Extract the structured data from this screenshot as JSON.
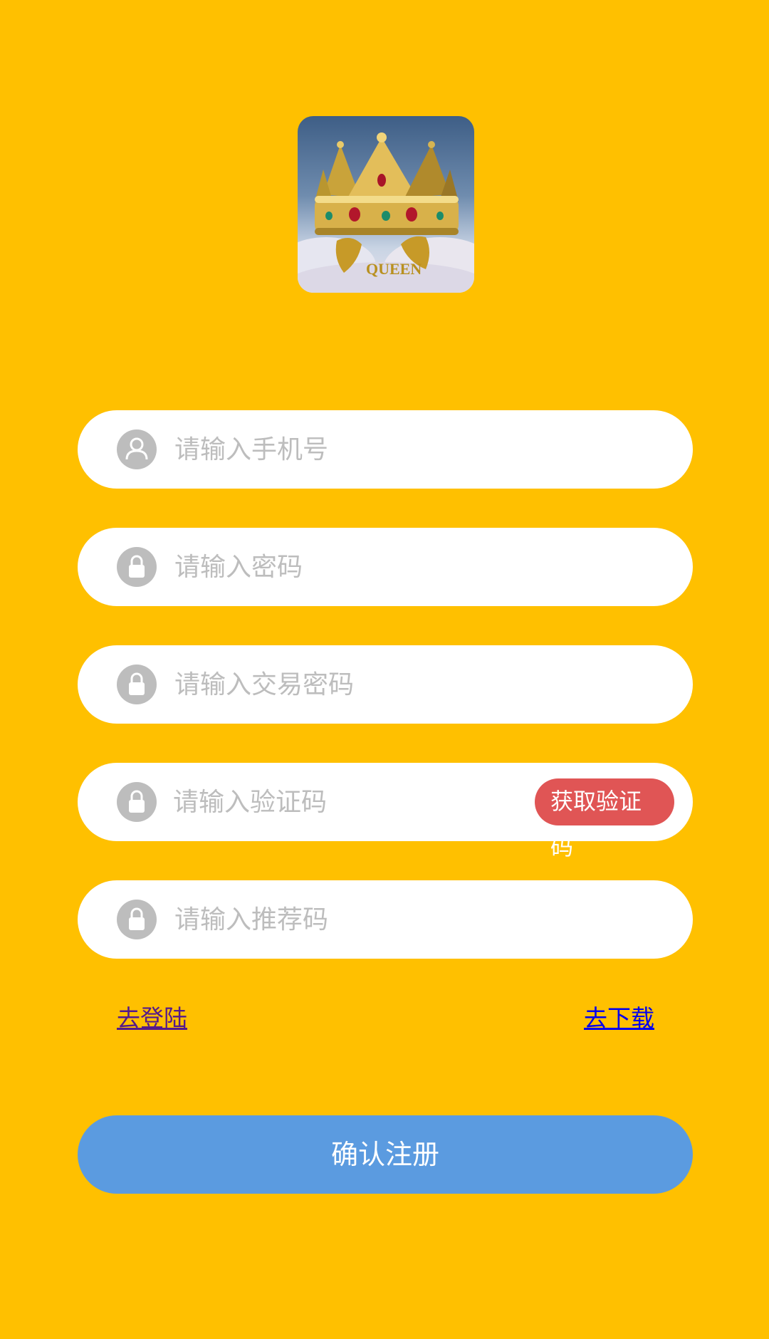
{
  "logo": {
    "text": "QUEEN",
    "alt": "crown-logo"
  },
  "form": {
    "phone_placeholder": "请输入手机号",
    "password_placeholder": "请输入密码",
    "trade_password_placeholder": "请输入交易密码",
    "code_placeholder": "请输入验证码",
    "get_code_label": "获取验证码",
    "referral_placeholder": "请输入推荐码"
  },
  "links": {
    "login": "去登陆",
    "download": "去下载"
  },
  "submit_label": "确认注册",
  "colors": {
    "background": "#FFC000",
    "submit": "#5B9BE0",
    "get_code": "#E05555",
    "icon": "#BDBDBD"
  }
}
